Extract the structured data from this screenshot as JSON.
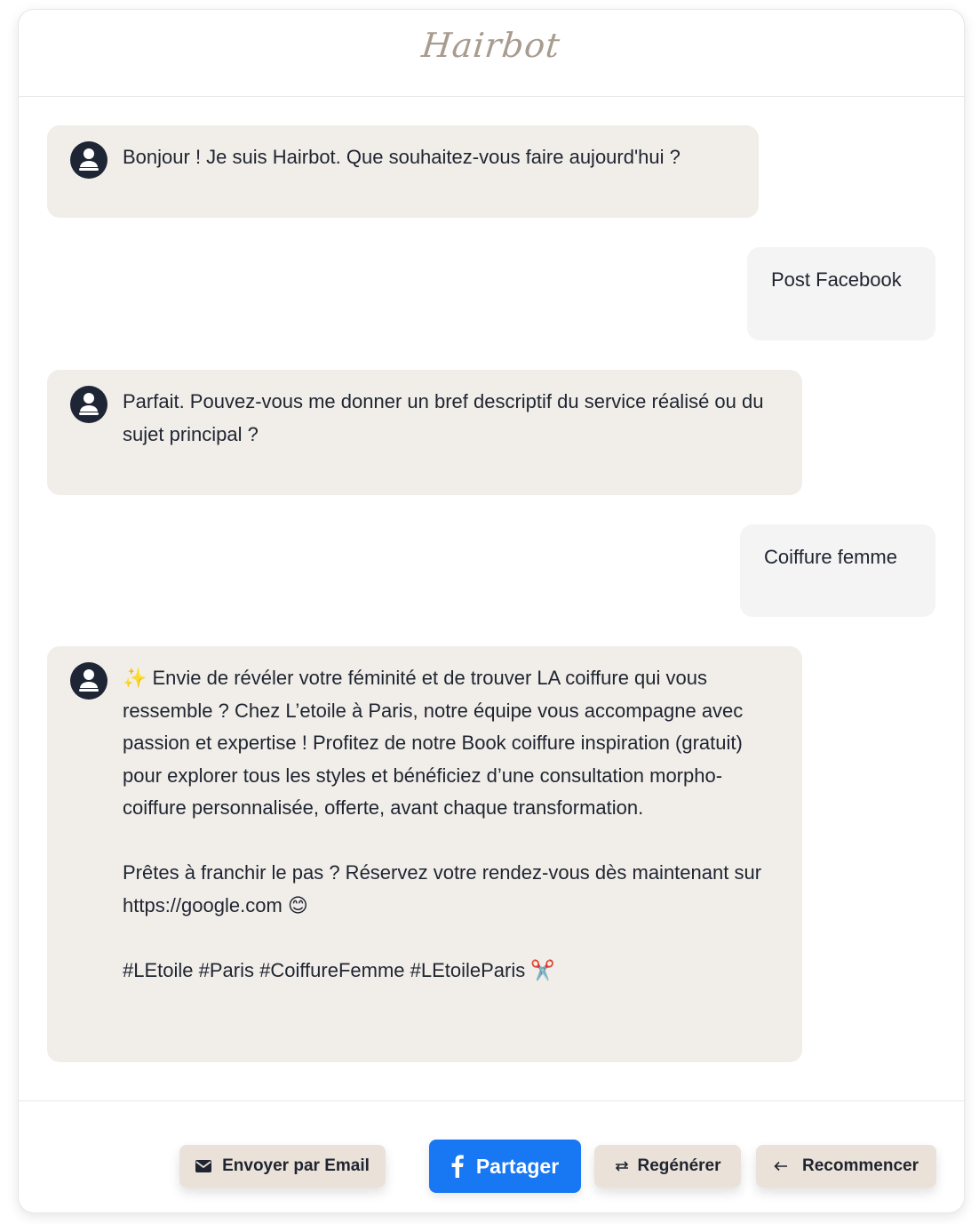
{
  "app": {
    "title": "Hairbot"
  },
  "messages": [
    {
      "role": "bot",
      "text": "Bonjour ! Je suis Hairbot. Que souhaitez-vous faire aujourd'hui ?"
    },
    {
      "role": "user",
      "text": "Post Facebook"
    },
    {
      "role": "bot",
      "text": "Parfait. Pouvez-vous me donner un bref descriptif du service réalisé ou du sujet principal ?"
    },
    {
      "role": "user",
      "text": "Coiffure femme"
    },
    {
      "role": "bot",
      "text": "✨ Envie de révéler votre féminité et de trouver LA coiffure qui vous ressemble ? Chez L’etoile à Paris, notre équipe vous accompagne avec passion et expertise ! Profitez de notre Book coiffure inspiration (gratuit) pour explorer tous les styles et bénéficiez d’une consultation morpho-coiffure personnalisée, offerte, avant chaque transformation.\n\nPrêtes à franchir le pas ? Réservez votre rendez-vous dès maintenant sur https://google.com 😊\n\n#LEtoile #Paris #CoiffureFemme #LEtoileParis ✂️"
    }
  ],
  "actions": {
    "email_label": "Envoyer par Email",
    "share_label": "Partager",
    "regenerate_label": "Regénérer",
    "restart_label": "Recommencer"
  },
  "colors": {
    "bot_bubble": "#f1eeea",
    "user_bubble": "#f4f4f4",
    "facebook_blue": "#1877f2",
    "secondary_button": "#eae1d8",
    "logo": "#a89b8f"
  },
  "icons": {
    "avatar": "user-avatar-icon",
    "email": "envelope-icon",
    "share": "facebook-icon",
    "regenerate": "swap-arrows-icon",
    "restart": "arrow-left-icon"
  }
}
